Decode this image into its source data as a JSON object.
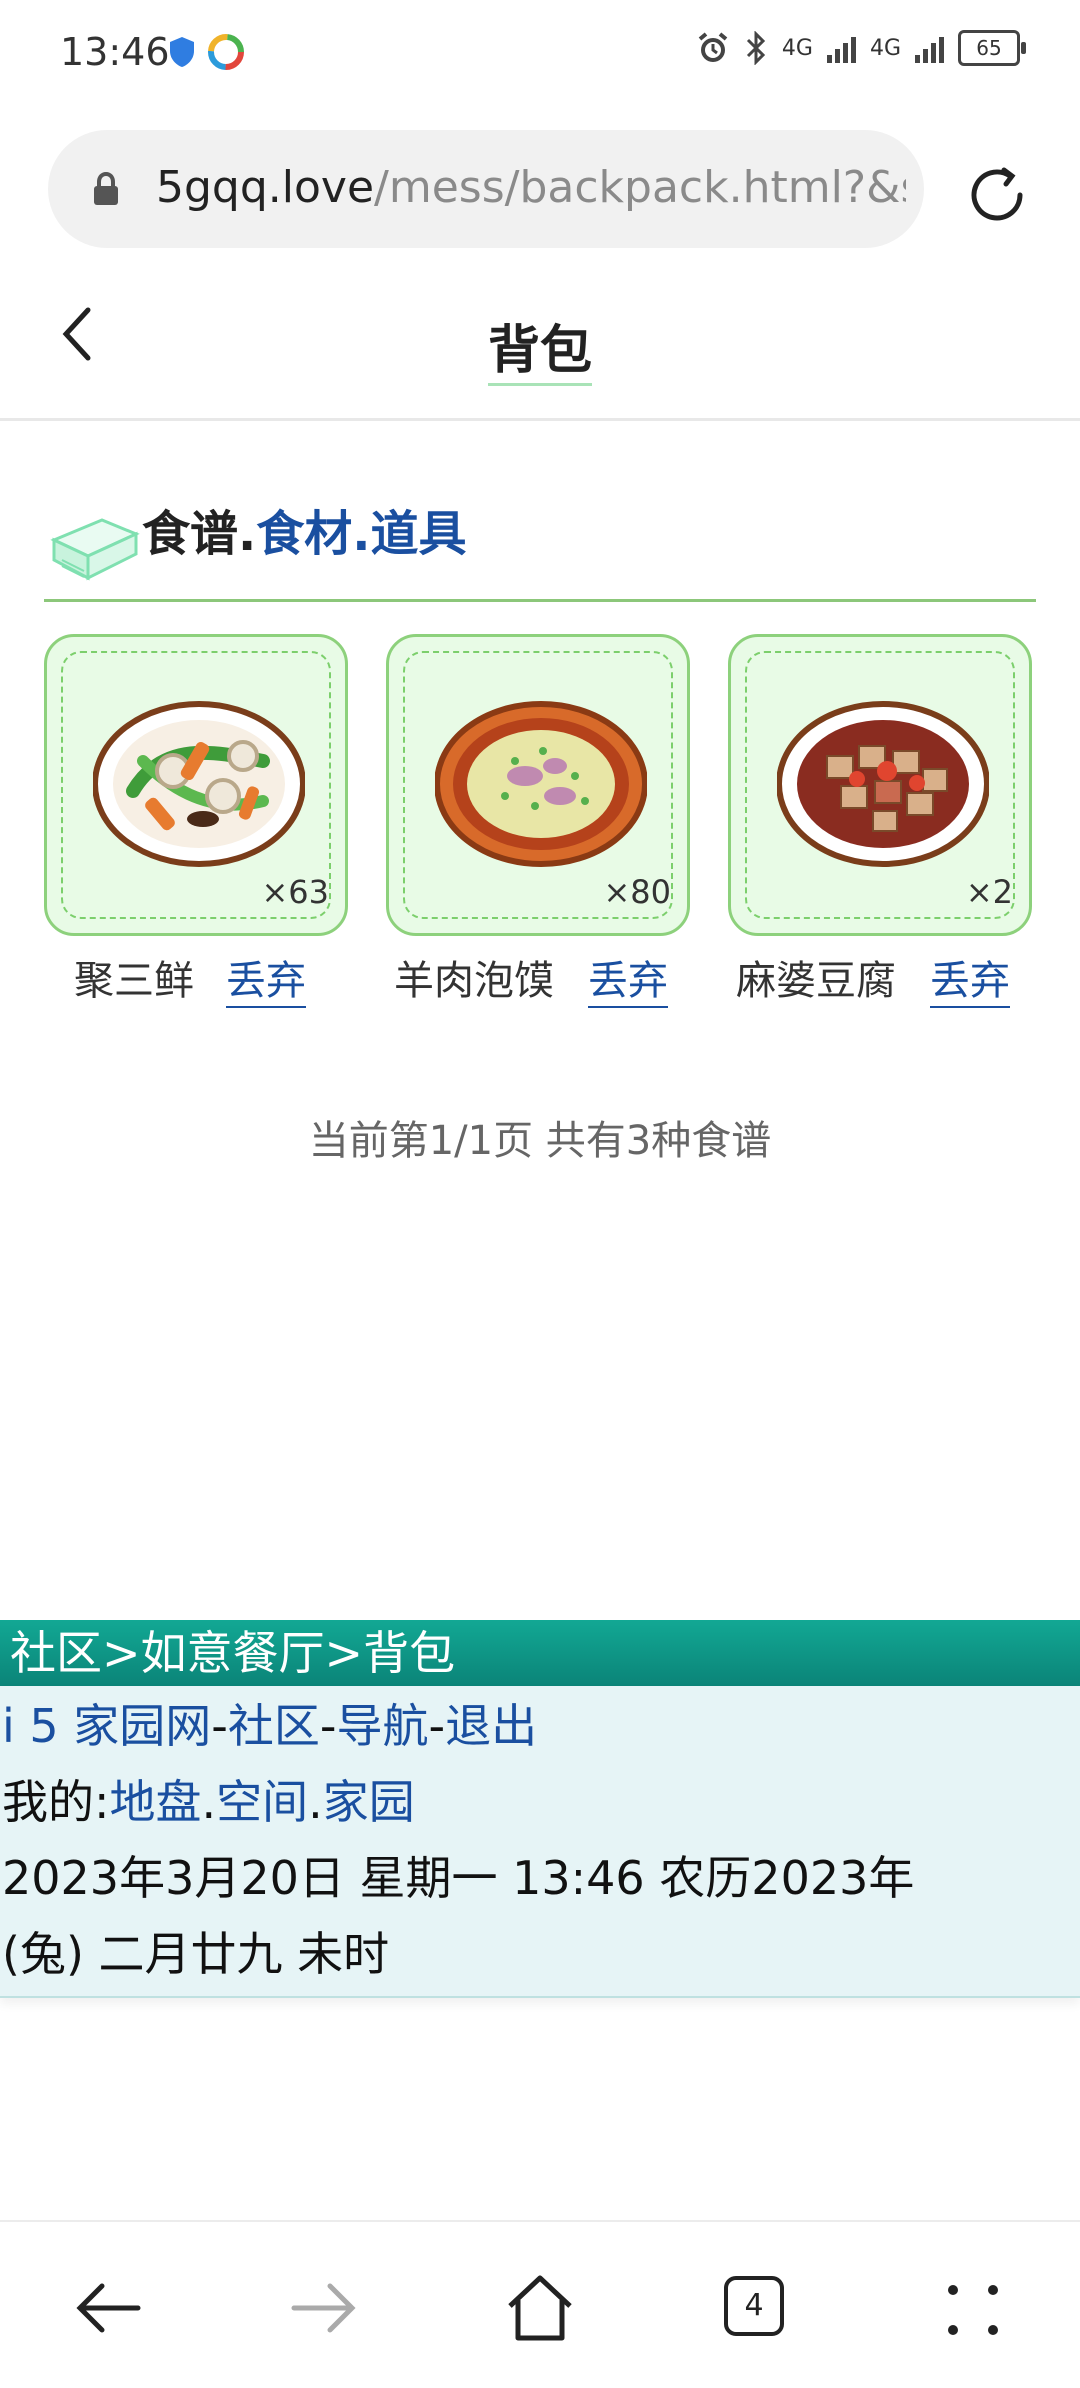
{
  "status_bar": {
    "time": "13:46",
    "network_1": "4G",
    "network_2": "4G",
    "battery": "65"
  },
  "browser": {
    "url_host": "5gqq.love",
    "url_path": "/mess/backpack.html?&si",
    "tab_count": "4"
  },
  "header": {
    "title": "背包"
  },
  "section": {
    "active_tab": "食谱",
    "separator1": ".",
    "tab2": "食材",
    "separator2": ".",
    "tab3": "道具"
  },
  "items": [
    {
      "name": "聚三鲜",
      "qty": "×63",
      "action": "丢弃"
    },
    {
      "name": "羊肉泡馍",
      "qty": "×80",
      "action": "丢弃"
    },
    {
      "name": "麻婆豆腐",
      "qty": "×2",
      "action": "丢弃"
    }
  ],
  "pagination": {
    "text": "当前第1/1页 共有3种食谱"
  },
  "footer": {
    "breadcrumb": "社区>如意餐厅>背包",
    "line1": {
      "site": "i 5 家园网",
      "sep1": "-",
      "community": "社区",
      "sep2": "-",
      "nav": "导航",
      "sep3": "-",
      "logout": "退出"
    },
    "line2": {
      "prefix": "我的:",
      "land": "地盘",
      "dot1": ".",
      "space": "空间",
      "dot2": ".",
      "home": "家园"
    },
    "datetime_line1": "2023年3月20日  星期一  13:46  农历2023年",
    "datetime_line2": "(兔)  二月廿九  未时"
  },
  "colors": {
    "accent_blue": "#1a4fa0",
    "card_green": "#8dd17c",
    "teal_bar": "#0b8478"
  }
}
